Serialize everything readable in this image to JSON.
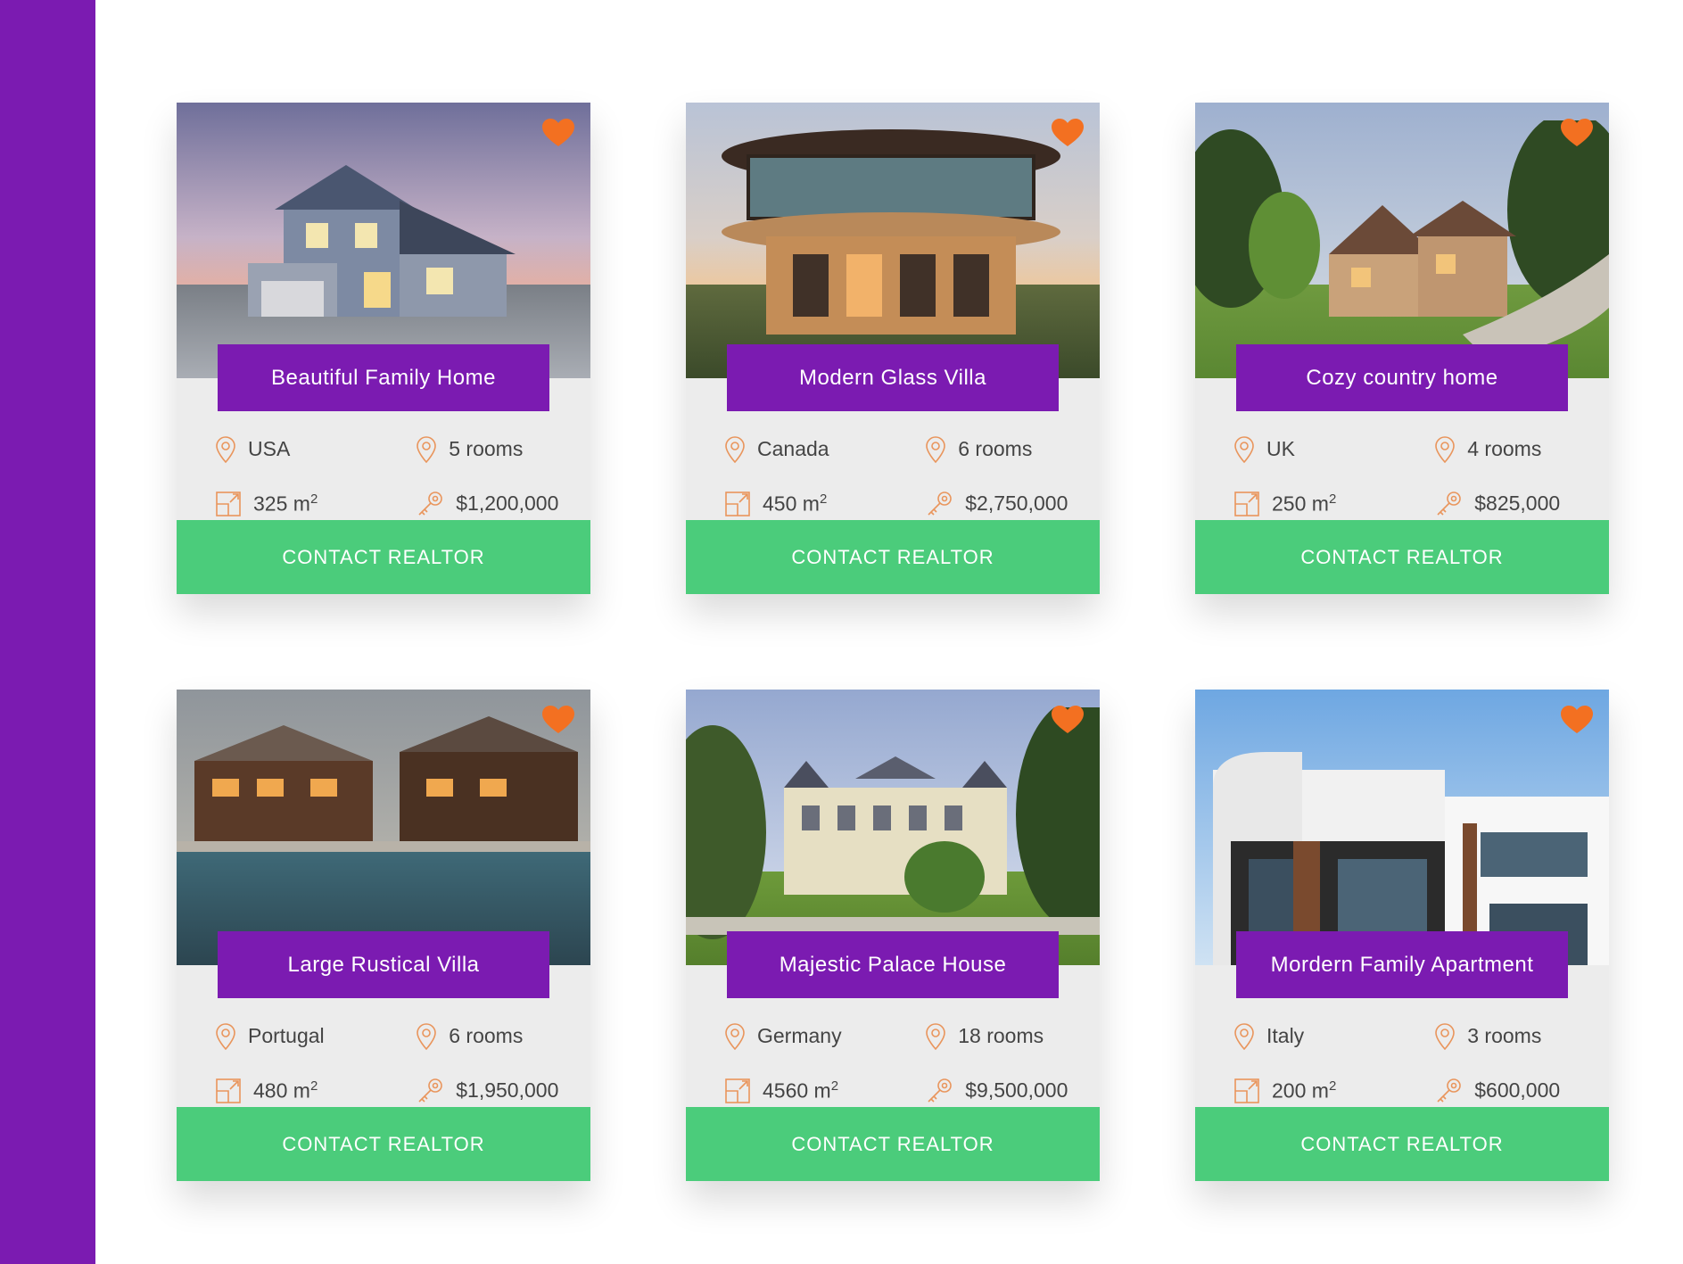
{
  "colors": {
    "accent": "#7b1bb1",
    "cta": "#4bcc7b",
    "heart": "#f37021",
    "icon": "#e9955c"
  },
  "cards": [
    {
      "title": "Beautiful Family Home",
      "country": "USA",
      "rooms": "5 rooms",
      "area": "325 m",
      "area_unit_sup": "2",
      "price": "$1,200,000",
      "cta": "CONTACT REALTOR",
      "favorite": true
    },
    {
      "title": "Modern Glass Villa",
      "country": "Canada",
      "rooms": "6 rooms",
      "area": "450 m",
      "area_unit_sup": "2",
      "price": "$2,750,000",
      "cta": "CONTACT REALTOR",
      "favorite": true
    },
    {
      "title": "Cozy country home",
      "country": "UK",
      "rooms": "4 rooms",
      "area": "250 m",
      "area_unit_sup": "2",
      "price": "$825,000",
      "cta": "CONTACT REALTOR",
      "favorite": true
    },
    {
      "title": "Large Rustical Villa",
      "country": "Portugal",
      "rooms": "6 rooms",
      "area": "480 m",
      "area_unit_sup": "2",
      "price": "$1,950,000",
      "cta": "CONTACT REALTOR",
      "favorite": true
    },
    {
      "title": "Majestic Palace House",
      "country": "Germany",
      "rooms": "18 rooms",
      "area": "4560 m",
      "area_unit_sup": "2",
      "price": "$9,500,000",
      "cta": "CONTACT REALTOR",
      "favorite": true
    },
    {
      "title": "Mordern Family Apartment",
      "country": "Italy",
      "rooms": "3 rooms",
      "area": "200 m",
      "area_unit_sup": "2",
      "price": "$600,000",
      "cta": "CONTACT REALTOR",
      "favorite": true
    }
  ]
}
